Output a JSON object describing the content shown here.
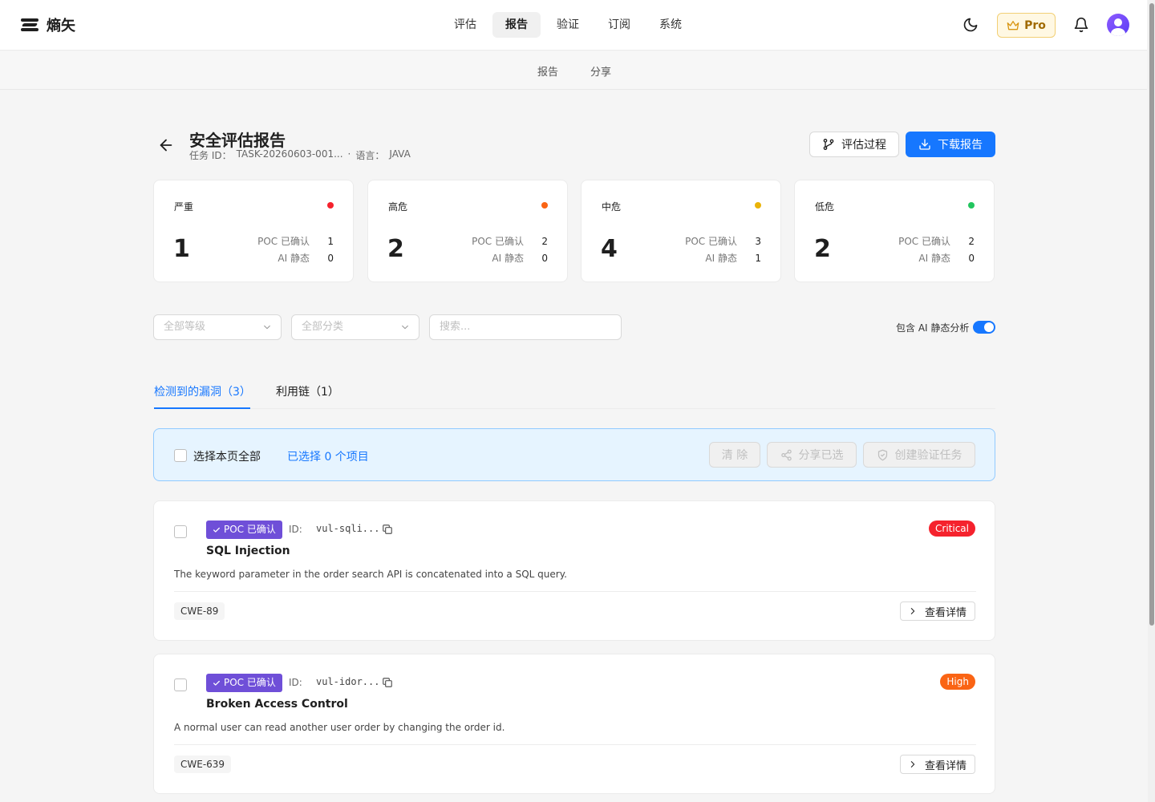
{
  "app": {
    "name": "熵矢"
  },
  "mainnav": [
    {
      "label": "评估",
      "active": false
    },
    {
      "label": "报告",
      "active": true
    },
    {
      "label": "验证",
      "active": false
    },
    {
      "label": "订阅",
      "active": false
    },
    {
      "label": "系统",
      "active": false
    }
  ],
  "header_right": {
    "pro_label": "Pro"
  },
  "subnav": [
    "报告",
    "分享"
  ],
  "report": {
    "title": "安全评估报告",
    "task_label": "任务 ID：",
    "task_id": "TASK-20260603-001...",
    "sep": "·",
    "lang_label": "语言：",
    "lang": "JAVA",
    "btn_process": "评估过程",
    "btn_download": "下载报告"
  },
  "stats": [
    {
      "label": "严重",
      "count": "1",
      "poc_label": "POC 已确认",
      "poc": "1",
      "ai_label": "AI 静态",
      "ai": "0",
      "color": "#f5222d"
    },
    {
      "label": "高危",
      "count": "2",
      "poc_label": "POC 已确认",
      "poc": "2",
      "ai_label": "AI 静态",
      "ai": "0",
      "color": "#fa6414"
    },
    {
      "label": "中危",
      "count": "4",
      "poc_label": "POC 已确认",
      "poc": "3",
      "ai_label": "AI 静态",
      "ai": "1",
      "color": "#eab308"
    },
    {
      "label": "低危",
      "count": "2",
      "poc_label": "POC 已确认",
      "poc": "2",
      "ai_label": "AI 静态",
      "ai": "0",
      "color": "#22c55e"
    }
  ],
  "filters": {
    "level_placeholder": "全部等级",
    "category_placeholder": "全部分类",
    "search_placeholder": "搜索...",
    "ai_toggle_label": "包含 AI 静态分析",
    "ai_toggle_on": true
  },
  "tabs": [
    {
      "label": "检测到的漏洞（3）",
      "active": true
    },
    {
      "label": "利用链（1）",
      "active": false
    }
  ],
  "selection": {
    "select_all": "选择本页全部",
    "count": "已选择 0 个项目",
    "clear": "清 除",
    "share": "分享已选",
    "create_task": "创建验证任务"
  },
  "vulns": [
    {
      "poc_badge": "POC 已确认",
      "id_label": "ID:",
      "id": "vul-sqli...",
      "severity": "Critical",
      "severity_color": "#f5222d",
      "title": "SQL Injection",
      "desc": "The keyword parameter in the order search API is concatenated into a SQL query.",
      "cwe": "CWE-89",
      "detail": "查看详情"
    },
    {
      "poc_badge": "POC 已确认",
      "id_label": "ID:",
      "id": "vul-idor...",
      "severity": "High",
      "severity_color": "#fa6414",
      "title": "Broken Access Control",
      "desc": "A normal user can read another user order by changing the order id.",
      "cwe": "CWE-639",
      "detail": "查看详情"
    }
  ],
  "icons": {
    "logo": "logo-icon",
    "moon": "moon-icon",
    "crown": "crown-icon",
    "bell": "bell-icon",
    "back": "arrow-left-icon",
    "branch": "branch-icon",
    "download": "download-icon",
    "chevron": "chevron-down-icon",
    "share": "share-icon",
    "shield": "shield-icon",
    "copy": "copy-icon",
    "check": "check-icon",
    "chevron_right": "chevron-right-icon"
  }
}
